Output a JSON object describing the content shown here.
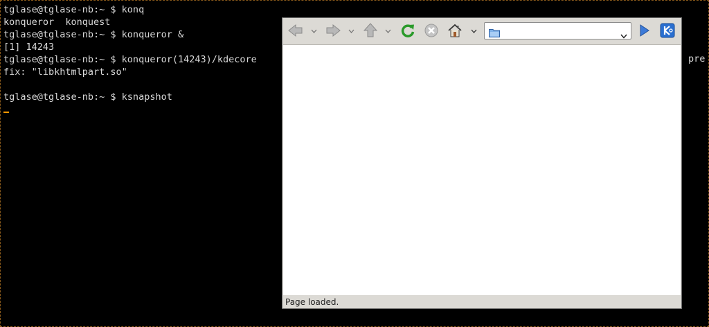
{
  "terminal": {
    "lines": [
      "tglase@tglase-nb:~ $ konq",
      "konqueror  konquest",
      "tglase@tglase-nb:~ $ konqueror &",
      "[1] 14243",
      "tglase@tglase-nb:~ $ konqueror(14243)/kdecore",
      "fix: \"libkhtmlpart.so\"",
      "",
      "tglase@tglase-nb:~ $ ksnapshot"
    ],
    "wrapped_tail": "pre"
  },
  "browser": {
    "toolbar": {
      "back_icon": "back-arrow-icon",
      "forward_icon": "forward-arrow-icon",
      "up_icon": "up-arrow-icon",
      "reload_icon": "reload-icon",
      "stop_icon": "stop-icon",
      "home_icon": "home-icon",
      "go_icon": "go-arrow-icon",
      "kde_icon": "kde-logo-icon"
    },
    "location": {
      "value": ""
    },
    "status": "Page loaded."
  },
  "colors": {
    "terminal_bg": "#000000",
    "terminal_fg": "#d8d8d8",
    "cursor": "#ff9800",
    "window_bg": "#dcdad5",
    "reload_green": "#2a9a2a",
    "go_blue": "#2a62c8"
  }
}
